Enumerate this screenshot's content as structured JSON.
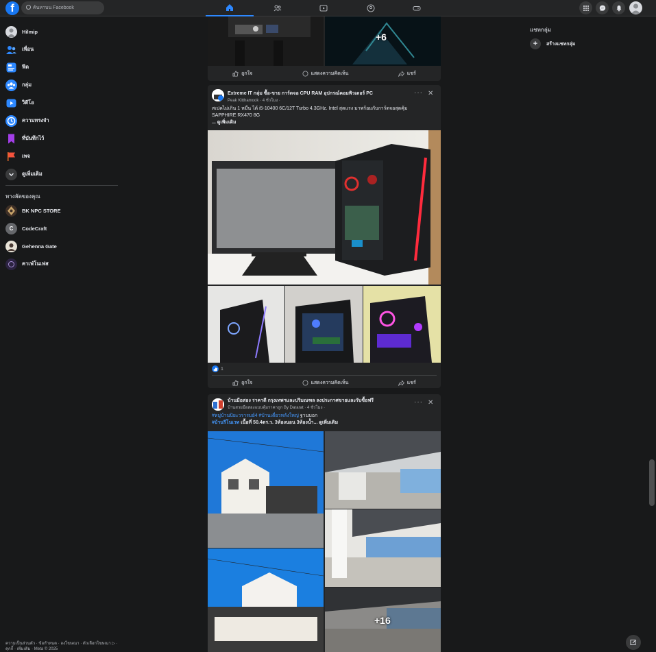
{
  "search": {
    "placeholder": "ค้นหาบน Facebook"
  },
  "sidebar": {
    "items": [
      {
        "label": "Hilmip"
      },
      {
        "label": "เพื่อน"
      },
      {
        "label": "ฟีด"
      },
      {
        "label": "กลุ่ม"
      },
      {
        "label": "วิดีโอ"
      },
      {
        "label": "ความทรงจำ"
      },
      {
        "label": "ที่บันทึกไว้"
      },
      {
        "label": "เพจ"
      },
      {
        "label": "ดูเพิ่มเติม"
      }
    ],
    "shortcuts_title": "ทางลัดของคุณ",
    "shortcuts": [
      {
        "label": "BK NPC STORE"
      },
      {
        "label": "CodeCraft",
        "initial": "C"
      },
      {
        "label": "Gehenna Gate"
      },
      {
        "label": "คาเฟ่โนเฟส"
      }
    ],
    "footer": "ความเป็นส่วนตัว · ข้อกำหนด · ลงโฆษณา · ตัวเลือกโฆษณา ▷ · คุกกี้ · เพิ่มเติม · Meta © 2025"
  },
  "actions": {
    "like": "ถูกใจ",
    "comment": "แสดงความคิดเห็น",
    "share": "แชร์"
  },
  "post0": {
    "more_count": "+6"
  },
  "post1": {
    "title": "Extreme IT กลุ่ม ซื้อ-ขาย การ์ดจอ CPU RAM อุปกรณ์คอมพิวเตอร์ PC",
    "author": "Peak Kitthamook",
    "time": "· 4 ชั่วโมง ·",
    "text_line1": "สเปคไม่เกิน 1 หมื่น ได้  i5-10400 6C/12T Turbo 4.3GHz. Intel สุดแรง มาพร้อมกับการ์ดจอสุดคุ้ม",
    "text_line2": "SAPPHIRE  RX470 8G",
    "see_more": "... ดูเพิ่มเติม",
    "reactions": "1"
  },
  "post2": {
    "title": "บ้านมือสอง ราคาดี กรุงเทพฯและปริมณฑล ลงประกาศขายและรับซื้อฟรี",
    "author": "บ้านสวยมือสองแบบคุ้มราคาถูก By Dararat",
    "time": "· 4 ชั่วโมง ·",
    "tag1": "#หมู่บ้านปิยะวรารมย์4",
    "tag2": "#บ้านเดี่ยวหลังใหญ่",
    "tag_text": " ฐานบอก",
    "tag3": "#บ้านรีโนเวท",
    "text_line2": " เนื้อที่ 50.4ตร.ว. 3ห้องนอน 3ห้องน้ำ... ดูเพิ่มเติม",
    "more_count": "+16"
  },
  "right": {
    "title": "แชทกลุ่ม",
    "create": "สร้างแชทกลุ่ม"
  },
  "colors": {
    "accent": "#2d88ff",
    "bg": "#18191a",
    "card": "#242526"
  }
}
